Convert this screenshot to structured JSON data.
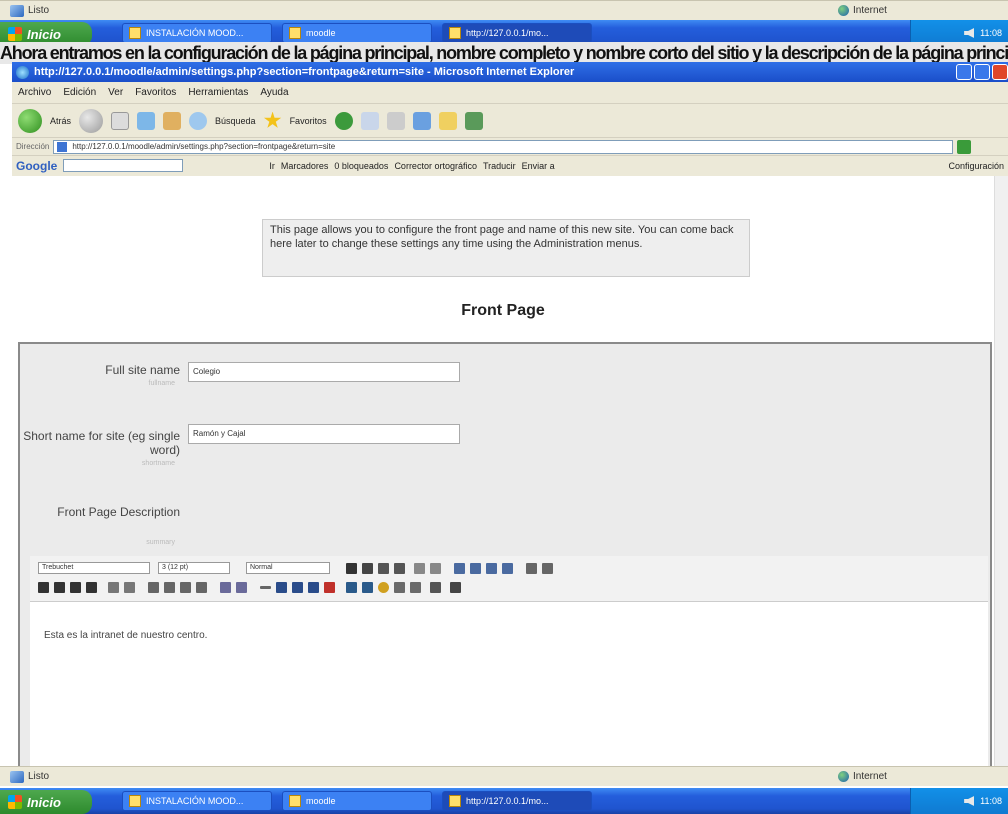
{
  "top_status": {
    "text": "Listo",
    "zone": "Internet"
  },
  "top_taskbar": {
    "start": "Inicio",
    "tasks": [
      "INSTALACIÓN MOOD...",
      "moodle",
      "http://127.0.0.1/mo..."
    ],
    "clock": "11:08"
  },
  "banner": {
    "text": "Ahora entramos en la configuración de la página principal, nombre completo y nombre corto del sitio y la descripción de la página principal."
  },
  "ie": {
    "title": "http://127.0.0.1/moodle/admin/settings.php?section=frontpage&return=site - Microsoft Internet Explorer",
    "menu": [
      "Archivo",
      "Edición",
      "Ver",
      "Favoritos",
      "Herramientas",
      "Ayuda"
    ],
    "toolbar": {
      "back": "Atrás",
      "search": "Búsqueda",
      "favorites": "Favoritos"
    },
    "address_label": "Dirección",
    "address": "http://127.0.0.1/moodle/admin/settings.php?section=frontpage&return=site",
    "google_label": "Google",
    "google_items": [
      "Ir",
      "Marcadores",
      "0 bloqueados",
      "Corrector ortográfico",
      "Traducir",
      "Enviar a"
    ],
    "settings": "Configuración"
  },
  "page": {
    "info": "This page allows you to configure the front page and name of this new site. You can come back here later to change these settings any time using the Administration menus.",
    "heading": "Front Page",
    "fields": [
      {
        "label": "Full site name",
        "hint": "fullname",
        "value": "Colegio"
      },
      {
        "label": "Short name for site (eg single word)",
        "hint": "shortname",
        "value": "Ramón y Cajal"
      },
      {
        "label": "Front Page Description",
        "hint": "summary"
      }
    ],
    "editor": {
      "font": "Trebuchet",
      "size": "3 (12 pt)",
      "format": "Normal",
      "content": "Esta es la intranet de nuestro centro."
    }
  },
  "bottom_status": {
    "text": "Listo",
    "zone": "Internet"
  },
  "bottom_taskbar": {
    "start": "Inicio",
    "tasks": [
      "INSTALACIÓN MOOD...",
      "moodle",
      "http://127.0.0.1/mo..."
    ],
    "clock": "11:08"
  },
  "colors": {
    "xp_blue": "#245edc",
    "start_green": "#3a9b3a",
    "page_bg": "#ebebeb"
  }
}
